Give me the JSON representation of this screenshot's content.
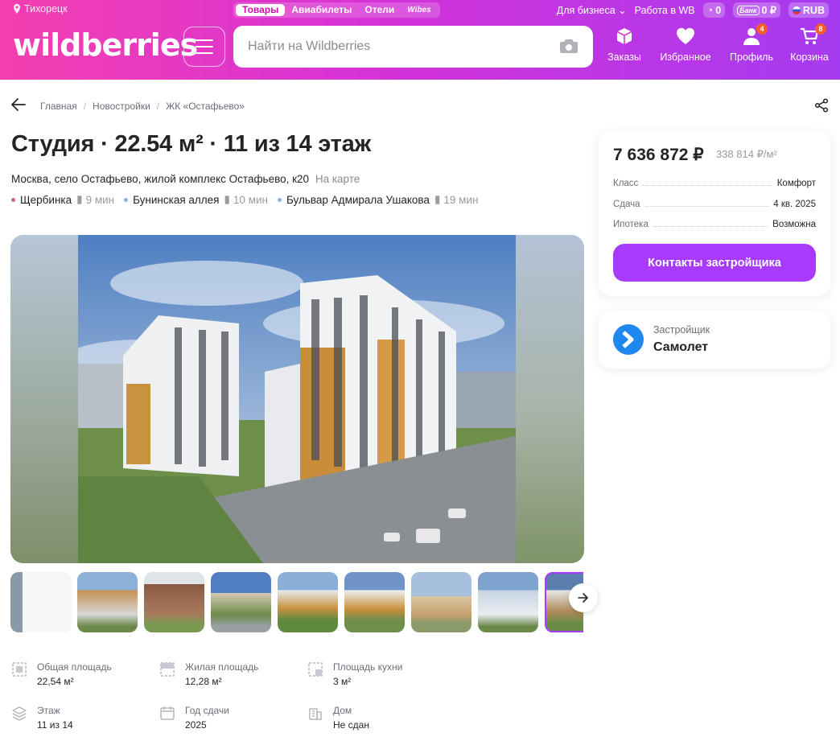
{
  "header": {
    "location": "Тихорецк",
    "services": [
      "Товары",
      "Авиабилеты",
      "Отели",
      "Wibes"
    ],
    "for_business": "Для бизнеса",
    "work_at_wb": "Работа в WB",
    "points": "0",
    "bank_label": "Банк",
    "bank_balance": "0 ₽",
    "currency": "RUB",
    "logo": "wildberries",
    "search_placeholder": "Найти на Wildberries",
    "nav": {
      "orders": "Заказы",
      "favorites": "Избранное",
      "profile": "Профиль",
      "profile_badge": "4",
      "cart": "Корзина",
      "cart_badge": "8"
    }
  },
  "breadcrumbs": [
    "Главная",
    "Новостройки",
    "ЖК «Остафьево»"
  ],
  "title": "Студия · 22.54 м² · 11 из 14 этаж",
  "address": "Москва, село Остафьево, жилой комплекс Остафьево, к20",
  "map_link": "На карте",
  "metro": [
    {
      "name": "Щербинка",
      "time": "9 мин",
      "color": "#c86a7a"
    },
    {
      "name": "Бунинская аллея",
      "time": "10 мин",
      "color": "#8fb0d8"
    },
    {
      "name": "Бульвар Адмирала Ушакова",
      "time": "19 мин",
      "color": "#8fb0d8"
    }
  ],
  "specs": [
    {
      "label": "Общая площадь",
      "value": "22,54 м²",
      "icon": "area-icon"
    },
    {
      "label": "Жилая площадь",
      "value": "12,28 м²",
      "icon": "living-area-icon"
    },
    {
      "label": "Площадь кухни",
      "value": "3 м²",
      "icon": "kitchen-area-icon"
    },
    {
      "label": "Этаж",
      "value": "11 из 14",
      "icon": "floor-icon"
    },
    {
      "label": "Год сдачи",
      "value": "2025",
      "icon": "calendar-icon"
    },
    {
      "label": "Дом",
      "value": "Не сдан",
      "icon": "building-icon"
    }
  ],
  "offer": {
    "price": "7 636 872 ₽",
    "price_per_m2": "338 814 ₽/м²",
    "rows": [
      {
        "key": "Класс",
        "value": "Комфорт"
      },
      {
        "key": "Сдача",
        "value": "4 кв. 2025"
      },
      {
        "key": "Ипотека",
        "value": "Возможна"
      }
    ],
    "contact_button": "Контакты застройщика"
  },
  "developer": {
    "label": "Застройщик",
    "name": "Самолет"
  },
  "colors": {
    "accent": "#a73afd",
    "header_start": "#f43fb0",
    "header_end": "#a53bf0"
  }
}
